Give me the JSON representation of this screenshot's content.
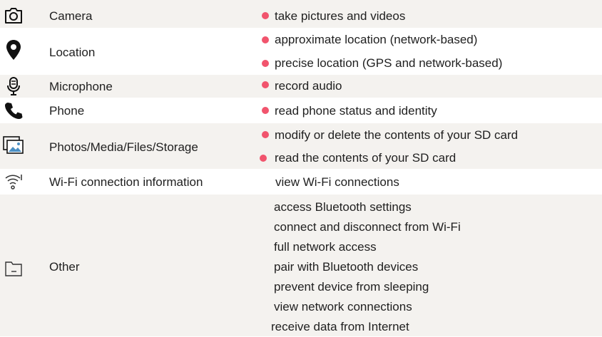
{
  "accent_color": "#f1546d",
  "groups": [
    {
      "name": "Camera",
      "icon": "camera-icon",
      "permissions": [
        {
          "text": "take pictures and videos",
          "dot": true
        }
      ]
    },
    {
      "name": "Location",
      "icon": "location-pin-icon",
      "permissions": [
        {
          "text": "approximate location (network-based)",
          "dot": true
        },
        {
          "text": "precise location (GPS and network-based)",
          "dot": true
        }
      ]
    },
    {
      "name": "Microphone",
      "icon": "microphone-icon",
      "permissions": [
        {
          "text": "record audio",
          "dot": true
        }
      ]
    },
    {
      "name": "Phone",
      "icon": "phone-icon",
      "permissions": [
        {
          "text": "read phone status and identity",
          "dot": true
        }
      ]
    },
    {
      "name": "Photos/Media/Files/Storage",
      "icon": "photo-icon",
      "permissions": [
        {
          "text": "modify or delete the contents of your SD card",
          "dot": true
        },
        {
          "text": "read the contents of your SD card",
          "dot": true
        }
      ]
    },
    {
      "name": "Wi-Fi connection information",
      "icon": "wifi-info-icon",
      "permissions": [
        {
          "text": "view Wi-Fi connections",
          "dot": false
        }
      ]
    },
    {
      "name": "Other",
      "icon": "folder-icon",
      "permissions": [
        {
          "text": "access Bluetooth settings",
          "dot": false
        },
        {
          "text": "connect and disconnect from Wi-Fi",
          "dot": false
        },
        {
          "text": "full network access",
          "dot": false
        },
        {
          "text": "pair with Bluetooth devices",
          "dot": false
        },
        {
          "text": "prevent device from sleeping",
          "dot": false
        },
        {
          "text": "view network connections",
          "dot": false
        },
        {
          "text": "receive data from Internet",
          "dot": false
        }
      ]
    }
  ]
}
